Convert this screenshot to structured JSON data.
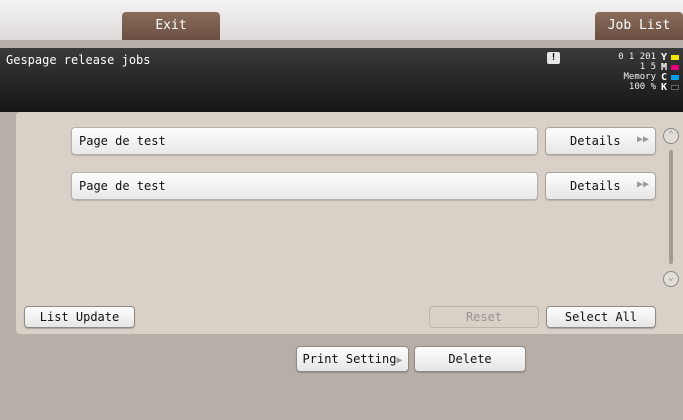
{
  "top_tabs": {
    "exit_label": "Exit",
    "job_list_label": "Job List"
  },
  "header": {
    "title": "Gespage release jobs",
    "warning_icon": "!",
    "status_line1": "0 1 201",
    "status_line2": "1 5",
    "memory_label": "Memory",
    "memory_value": "100 %"
  },
  "toner": [
    {
      "letter": "Y",
      "color": "#f2e600"
    },
    {
      "letter": "M",
      "color": "#e5007e"
    },
    {
      "letter": "C",
      "color": "#00a0e9"
    },
    {
      "letter": "K",
      "color": "#1a1a1a"
    }
  ],
  "jobs": [
    {
      "name": "Page de test",
      "details_label": "Details"
    },
    {
      "name": "Page de test",
      "details_label": "Details"
    }
  ],
  "buttons": {
    "list_update": "List Update",
    "reset": "Reset",
    "select_all": "Select All",
    "print_setting": "Print Setting",
    "delete": "Delete"
  },
  "colors": {
    "accent_brown": "#7a5c4b",
    "panel_bg": "#d9d0c8",
    "frame_bg": "#b7aea7"
  },
  "icons": {
    "details_arrow": "double-chevron-right-icon",
    "scroll_up": "scroll-up-icon",
    "scroll_down": "scroll-down-icon"
  }
}
